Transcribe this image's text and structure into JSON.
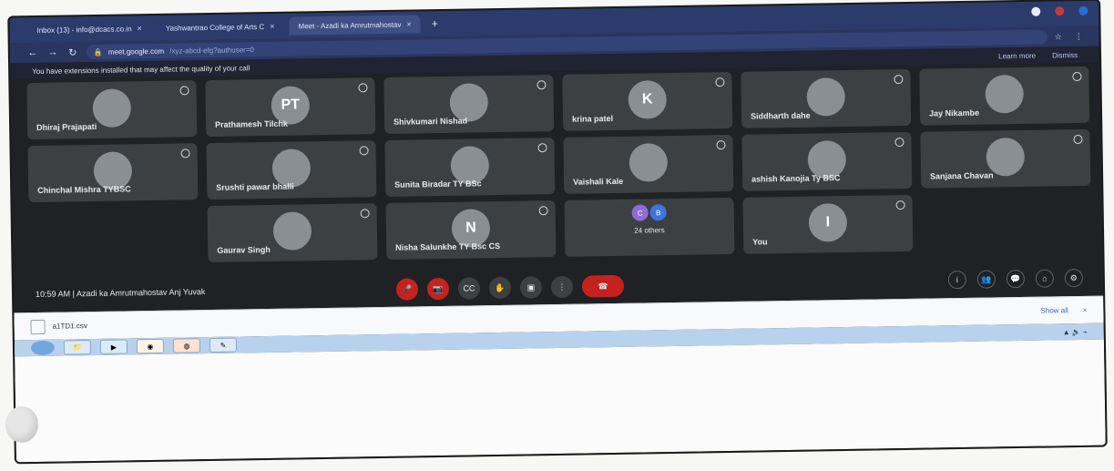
{
  "browser": {
    "tabs": [
      {
        "label": "Inbox (13) - info@dcacs.co.in",
        "active": false
      },
      {
        "label": "Yashwantrao College of Arts C",
        "active": false
      },
      {
        "label": "Meet - Azadi ka Amrutmahostav",
        "active": true
      }
    ],
    "address": {
      "domain": "meet.google.com",
      "url_rest": "/xyz-abcd-efg?authuser=0"
    }
  },
  "banner": {
    "message": "You have extensions installed that may affect the quality of your call",
    "learn_more": "Learn more",
    "dismiss": "Dismiss"
  },
  "participants": [
    {
      "name": "Dhiraj Prajapati",
      "avatar": "photo"
    },
    {
      "name": "Prathamesh Tilchk",
      "avatar": "PT"
    },
    {
      "name": "Shivkumari Nishad",
      "avatar": "photo"
    },
    {
      "name": "krina patel",
      "avatar": "K"
    },
    {
      "name": "Siddharth dahe",
      "avatar": "photo"
    },
    {
      "name": "Jay Nikambe",
      "avatar": "photo"
    },
    {
      "name": "Chinchal Mishra TYBSC",
      "avatar": "photo"
    },
    {
      "name": "Srushti pawar bhalli",
      "avatar": "photo"
    },
    {
      "name": "Sunita Biradar TY BSc",
      "avatar": "photo"
    },
    {
      "name": "Vaishali Kale",
      "avatar": "photo"
    },
    {
      "name": "ashish Kanojia Ty BSC",
      "avatar": "dark"
    },
    {
      "name": "Sanjana Chavan",
      "avatar": "photo"
    },
    {
      "name": "Gaurav Singh",
      "avatar": "photo"
    },
    {
      "name": "Nisha Salunkhe TY Bsc CS",
      "avatar": "N"
    },
    {
      "name": "24 others",
      "avatar": "others"
    },
    {
      "name": "You",
      "avatar": "I"
    }
  ],
  "meeting": {
    "time": "10:59 AM",
    "separator": "|",
    "title": "Azadi ka Amrutmahostav Anj Yuvak"
  },
  "download": {
    "file": "a1TD1.csv",
    "show_all": "Show all"
  }
}
